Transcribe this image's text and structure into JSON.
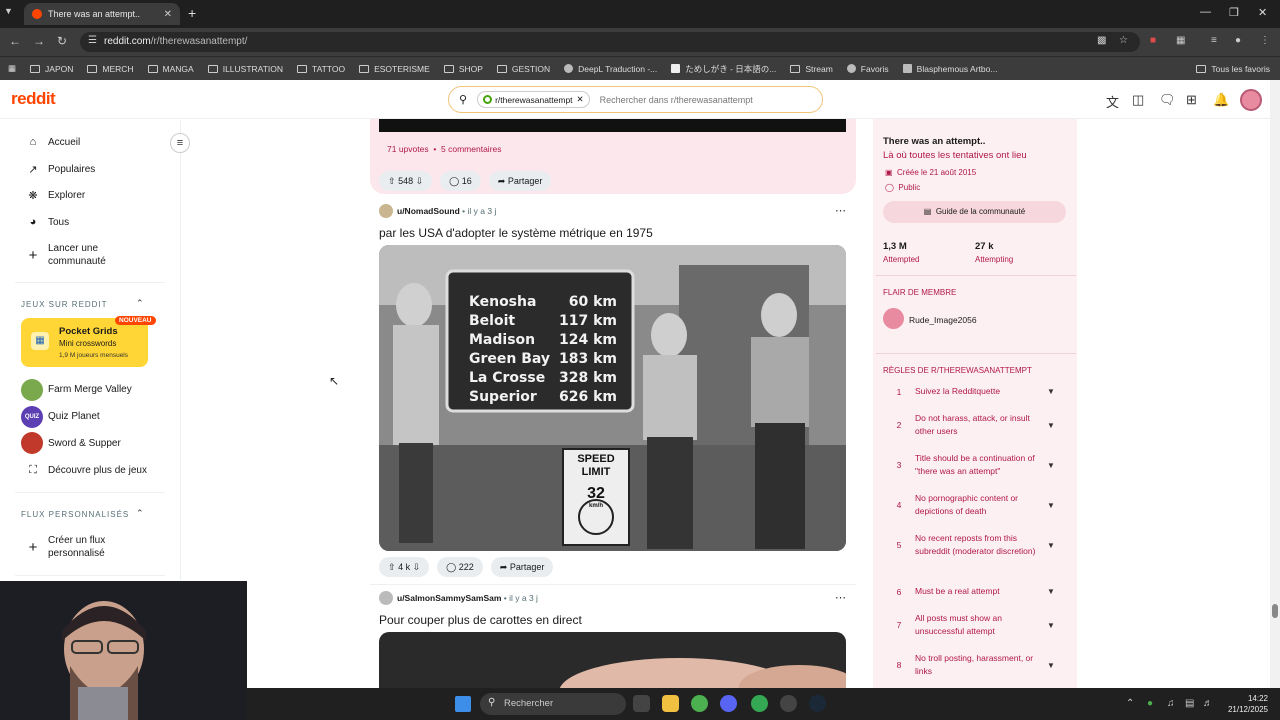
{
  "browser": {
    "tab_title": "There was an attempt..",
    "url_host": "reddit.com",
    "url_path": "/r/therewasanattempt/",
    "bookmarks": [
      "JAPON",
      "MERCH",
      "MANGA",
      "ILLUSTRATION",
      "TATTOO",
      "ESOTERISME",
      "SHOP",
      "GESTION",
      "DeepL Traduction -...",
      "ためしがき - 日本語の...",
      "Stream",
      "Favoris",
      "Blasphemous Artbo..."
    ],
    "all_bookmarks": "Tous les favoris"
  },
  "header": {
    "logo": "reddit",
    "search_chip": "r/therewasanattempt",
    "search_placeholder": "Rechercher dans r/therewasanattempt"
  },
  "sidebar": {
    "nav": [
      "Accueil",
      "Populaires",
      "Explorer",
      "Tous"
    ],
    "create_community": [
      "Lancer une",
      "communauté"
    ],
    "games_header": "JEUX SUR REDDIT",
    "featured_game": {
      "name": "Pocket Grids",
      "subtitle": "Mini crosswords",
      "meta": "1,9 M joueurs mensuels",
      "badge": "NOUVEAU"
    },
    "games": [
      "Farm Merge Valley",
      "Quiz Planet",
      "Sword & Supper"
    ],
    "more_games": "Découvre plus de jeux",
    "feeds_header": "FLUX PERSONNALISÉS",
    "create_feed": [
      "Créer un flux",
      "personnalisé"
    ]
  },
  "feed": {
    "prev_post": {
      "upvotes_text": "71 upvotes",
      "comments_text": "5 commentaires",
      "votes": "548",
      "comments": "16",
      "share": "Partager"
    },
    "post1": {
      "author": "u/NomadSound",
      "age": "il y a 3 j",
      "title": "par les USA d'adopter le système métrique en 1975",
      "votes": "4 k",
      "comments": "222",
      "share": "Partager",
      "sign": [
        [
          "Kenosha",
          "60 km"
        ],
        [
          "Beloit",
          "117 km"
        ],
        [
          "Madison",
          "124 km"
        ],
        [
          "Green Bay",
          "183 km"
        ],
        [
          "La Crosse",
          "328 km"
        ],
        [
          "Superior",
          "626 km"
        ]
      ],
      "speed_sign": [
        "SPEED",
        "LIMIT",
        "32",
        "km/h"
      ]
    },
    "post2": {
      "author": "u/SalmonSammySamSam",
      "age": "il y a 3 j",
      "title": "Pour couper plus de carottes en direct"
    }
  },
  "community": {
    "name": "There was an attempt..",
    "tagline": "Là où toutes les tentatives ont lieu",
    "created": "Créée le 21 août 2015",
    "visibility": "Public",
    "guide": "Guide de la communauté",
    "members": "1,3 M",
    "members_label": "Attempted",
    "online": "27 k",
    "online_label": "Attempting",
    "flair_header": "FLAIR DE MEMBRE",
    "flair_user": "Rude_Image2056",
    "rules_header": "RÈGLES DE R/THEREWASANATTEMPT",
    "rules": [
      {
        "n": "1",
        "text": "Suivez la Redditquette"
      },
      {
        "n": "2",
        "text": "Do not harass, attack, or insult other users"
      },
      {
        "n": "3",
        "text": "Title should be a continuation of \"there was an attempt\""
      },
      {
        "n": "4",
        "text": "No pornographic content or depictions of death"
      },
      {
        "n": "5",
        "text": "No recent reposts from this subreddit (moderator discretion)"
      },
      {
        "n": "6",
        "text": "Must be a real attempt"
      },
      {
        "n": "7",
        "text": "All posts must show an unsuccessful attempt"
      },
      {
        "n": "8",
        "text": "No troll posting, harassment, or links"
      }
    ]
  },
  "taskbar": {
    "search": "Rechercher",
    "time": "14:22",
    "date": "21/12/2025"
  },
  "colors": {
    "brand": "#ff4500",
    "community_accent": "#b0184c",
    "panel_bg": "#fdf0f2"
  }
}
